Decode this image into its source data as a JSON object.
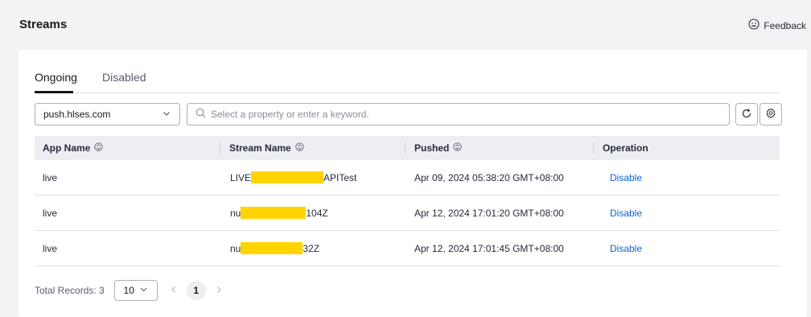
{
  "header": {
    "title": "Streams",
    "feedback_label": "Feedback"
  },
  "tabs": [
    {
      "label": "Ongoing",
      "active": true
    },
    {
      "label": "Disabled",
      "active": false
    }
  ],
  "filters": {
    "domain_select": "push.hlses.com",
    "search_placeholder": "Select a property or enter a keyword."
  },
  "table": {
    "columns": [
      "App Name",
      "Stream Name",
      "Pushed",
      "Operation"
    ],
    "rows": [
      {
        "app": "live",
        "stream_prefix": "LIVE",
        "stream_suffix": "APITest",
        "pushed": "Apr 09, 2024 05:38:20 GMT+08:00",
        "operation": "Disable"
      },
      {
        "app": "live",
        "stream_prefix": "nu",
        "stream_suffix": "104Z",
        "pushed": "Apr 12, 2024 17:01:20 GMT+08:00",
        "operation": "Disable"
      },
      {
        "app": "live",
        "stream_prefix": "nu",
        "stream_suffix": "32Z",
        "pushed": "Apr 12, 2024 17:01:45 GMT+08:00",
        "operation": "Disable"
      }
    ]
  },
  "pagination": {
    "total_label": "Total Records: 3",
    "page_size": "10",
    "current_page": "1"
  },
  "colors": {
    "link": "#0b62d6",
    "redaction": "#ffd400",
    "header_bg": "#eceef1"
  }
}
